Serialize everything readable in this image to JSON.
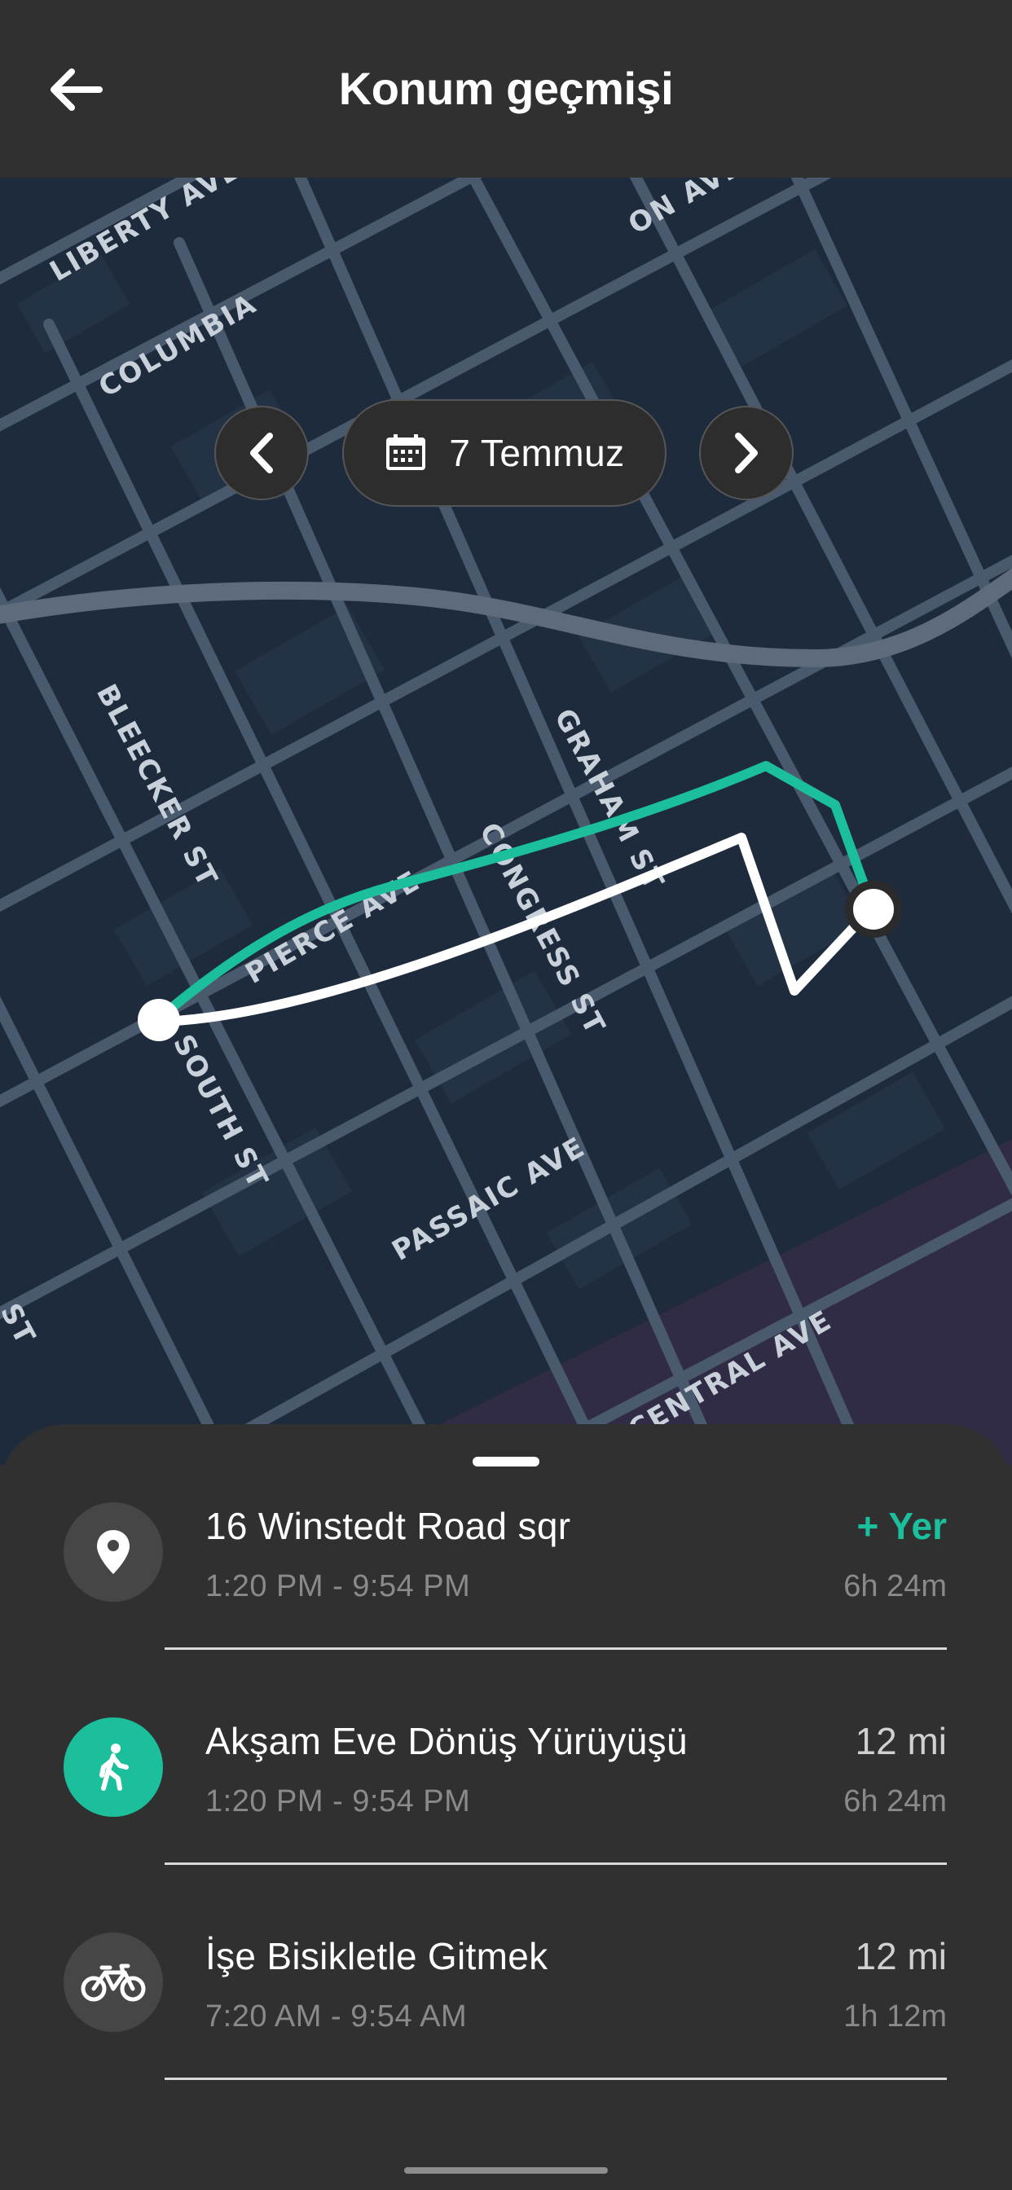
{
  "header": {
    "title": "Konum geçmişi",
    "back_icon": "arrow-left-icon"
  },
  "map": {
    "date_label": "7 Temmuz",
    "prev_icon": "chevron-left-icon",
    "next_icon": "chevron-right-icon",
    "calendar_icon": "calendar-icon",
    "street_labels": [
      "LIBERTY AVE",
      "COLUMBIA",
      "ON AVE",
      "BLEECKER ST",
      "GRAHAM ST",
      "CONGRESS ST",
      "PIERCE AVE",
      "SOUTH ST",
      "PASSAIC AVE",
      "CENTRAL AVE",
      "ST"
    ],
    "route_colors": {
      "green": "#1cbf9b",
      "white": "#ffffff"
    }
  },
  "timeline": {
    "items": [
      {
        "icon": "location-pin-icon",
        "name": "16 Winstedt Road sqr",
        "times": "1:20 PM - 9:54 PM",
        "right_top": "+ Yer",
        "right_bottom": "6h 24m"
      },
      {
        "icon": "walking-icon",
        "name": "Akşam Eve Dönüş Yürüyüşü",
        "times": "1:20 PM - 9:54 PM",
        "right_top": "12 mi",
        "right_bottom": "6h 24m"
      },
      {
        "icon": "bicycle-icon",
        "name": "İşe Bisikletle Gitmek",
        "times": "7:20 AM - 9:54 AM",
        "right_top": "12 mi",
        "right_bottom": "1h 12m"
      }
    ]
  },
  "colors": {
    "accent": "#1cbf9b",
    "background": "#303030",
    "map": "#1d2b3d"
  }
}
